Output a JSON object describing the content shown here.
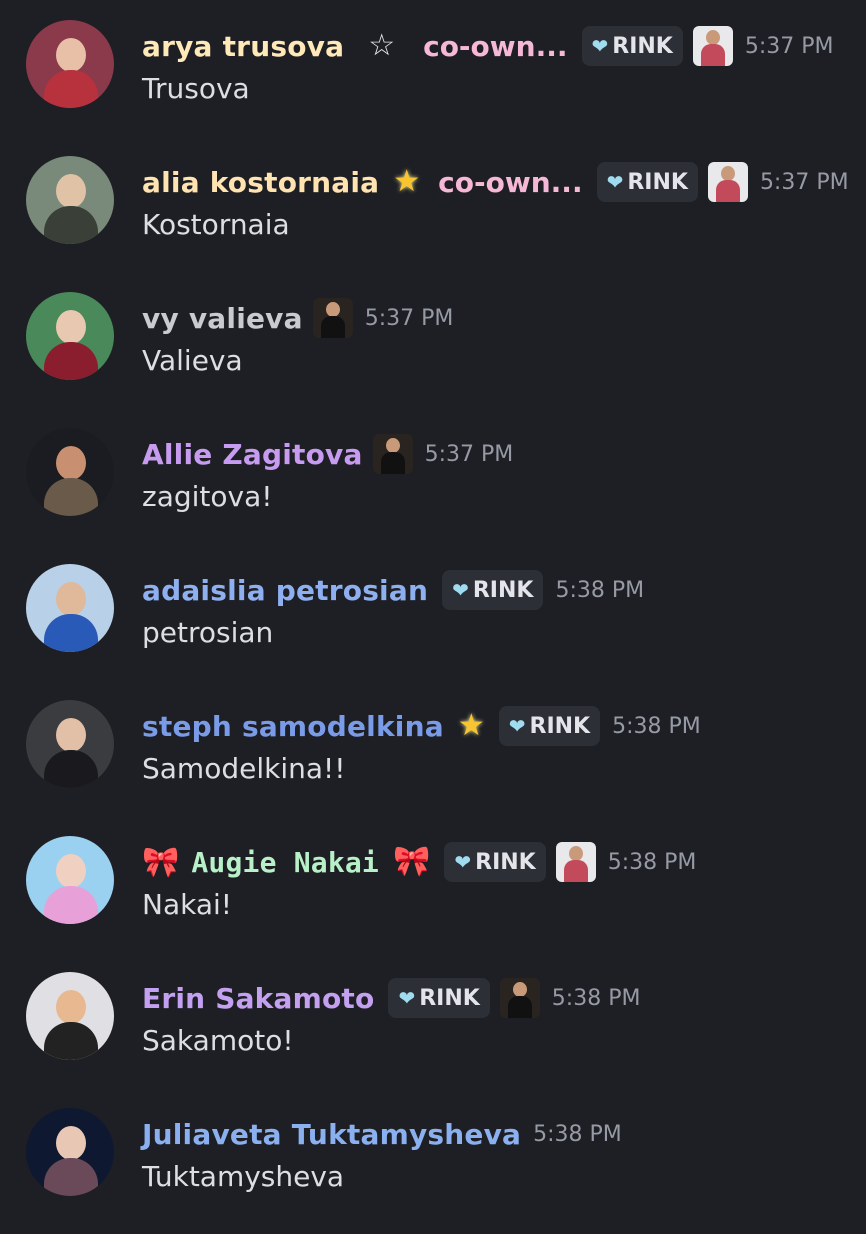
{
  "messages": [
    {
      "name": "arya trusova",
      "prefix": "",
      "suffix": "☆",
      "suffix_style": "outline",
      "co": "co-own...",
      "rink": true,
      "mini": "light",
      "time": "5:37 PM",
      "text": "Trusova",
      "name_color": "#ffe9b8",
      "avatar": {
        "bg": "#8a3a4a",
        "head": "#e8c0a8",
        "body": "#b8323e"
      }
    },
    {
      "name": "alia kostornaia",
      "prefix": "",
      "suffix": "★",
      "suffix_style": "gold",
      "co": "co-own...",
      "rink": true,
      "mini": "light",
      "time": "5:37 PM",
      "text": "Kostornaia",
      "name_color": "#ffe3b0",
      "avatar": {
        "bg": "#7a8a7a",
        "head": "#e0c2a6",
        "body": "#3a3f38"
      }
    },
    {
      "name": "vy valieva",
      "prefix": "",
      "suffix": "",
      "suffix_style": "",
      "co": "",
      "rink": false,
      "mini": "dark",
      "time": "5:37 PM",
      "text": "Valieva",
      "name_color": "#c9cbd0",
      "avatar": {
        "bg": "#4a8a5a",
        "head": "#e8c8b0",
        "body": "#8a1e2e"
      }
    },
    {
      "name": "Allie Zagitova",
      "prefix": "",
      "suffix": "",
      "suffix_style": "",
      "co": "",
      "rink": false,
      "mini": "dark",
      "time": "5:37 PM",
      "text": "zagitova!",
      "name_color": "#c79cf0",
      "avatar": {
        "bg": "#1a1c22",
        "head": "#c89070",
        "body": "#6a5a4a"
      }
    },
    {
      "name": "adaislia petrosian",
      "prefix": "",
      "suffix": "",
      "suffix_style": "",
      "co": "",
      "rink": true,
      "mini": "",
      "time": "5:38 PM",
      "text": "petrosian",
      "name_color": "#8eb0f0",
      "avatar": {
        "bg": "#b8d0e8",
        "head": "#e0b89a",
        "body": "#2a5ab8"
      }
    },
    {
      "name": "steph samodelkina",
      "prefix": "",
      "suffix": "★",
      "suffix_style": "gold",
      "co": "",
      "rink": true,
      "mini": "",
      "time": "5:38 PM",
      "text": "Samodelkina!!",
      "name_color": "#7a9ce8",
      "avatar": {
        "bg": "#3a3c40",
        "head": "#e2c0a8",
        "body": "#1a1a1e"
      }
    },
    {
      "name": "Augie Nakai",
      "prefix": "🎀",
      "suffix": "🎀",
      "suffix_style": "bow",
      "co": "",
      "rink": true,
      "mini": "light",
      "time": "5:38 PM",
      "text": "Nakai!",
      "name_color": "#b8f0c8",
      "avatar": {
        "bg": "#9ad0f0",
        "head": "#f0d0c0",
        "body": "#e8a0d8"
      }
    },
    {
      "name": "Erin Sakamoto",
      "prefix": "",
      "suffix": "",
      "suffix_style": "",
      "co": "",
      "rink": true,
      "mini": "dark",
      "time": "5:38 PM",
      "text": "Sakamoto!",
      "name_color": "#c4a0f0",
      "avatar": {
        "bg": "#e0e0e4",
        "head": "#e8b890",
        "body": "#222"
      }
    },
    {
      "name": "Juliaveta Tuktamysheva",
      "prefix": "",
      "suffix": "",
      "suffix_style": "",
      "co": "",
      "rink": false,
      "mini": "",
      "time": "5:38 PM",
      "text": "Tuktamysheva",
      "name_color": "#8ab0f0",
      "avatar": {
        "bg": "#0e1830",
        "head": "#e8c8b4",
        "body": "#6a4a58"
      }
    }
  ],
  "rink_label": "RINK",
  "rink_icon": "diamond-heart-icon"
}
